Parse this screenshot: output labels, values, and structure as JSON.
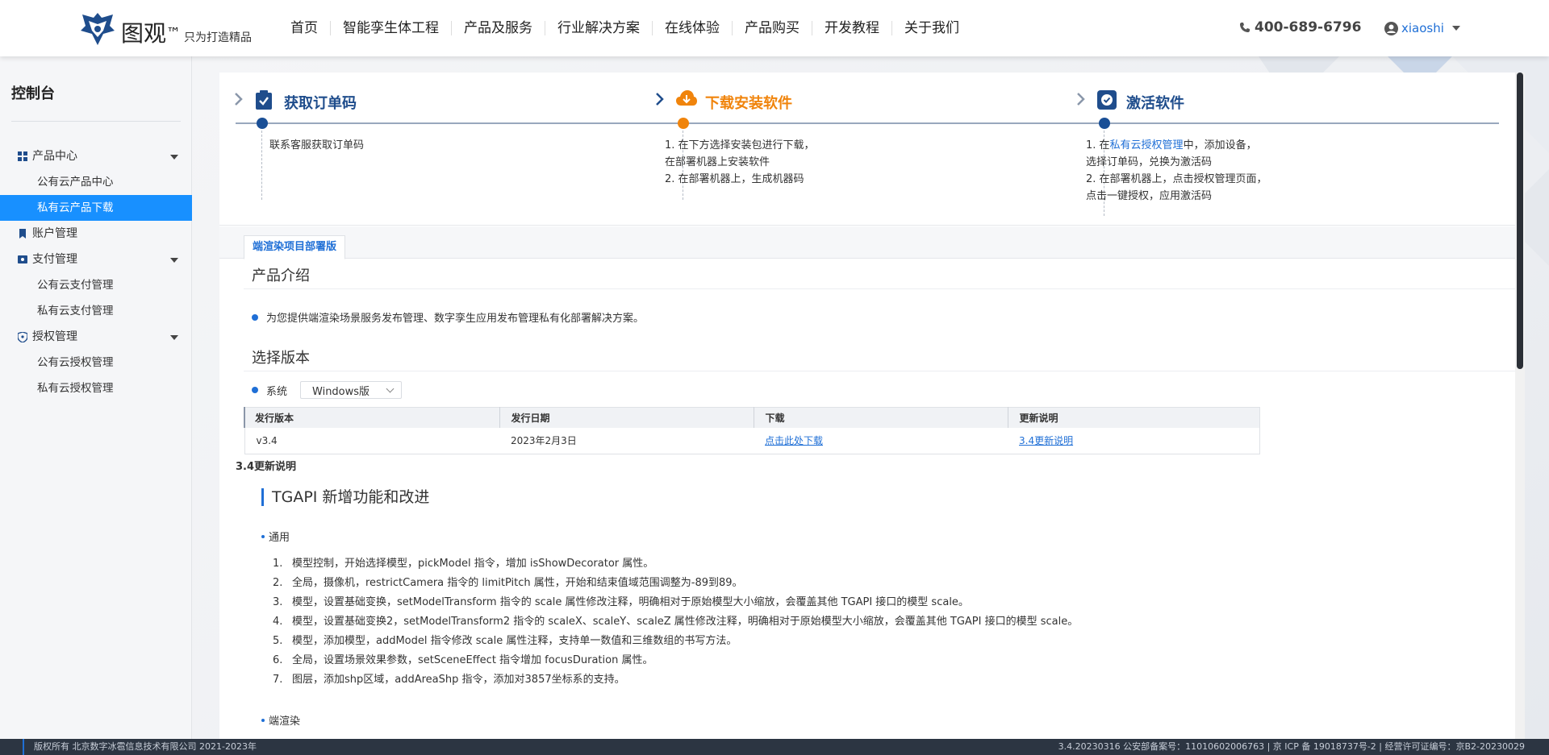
{
  "header": {
    "logo_text": "图观",
    "logo_tm": "™",
    "logo_slogan": "只为打造精品",
    "nav": [
      "首页",
      "智能孪生体工程",
      "产品及服务",
      "行业解决方案",
      "在线体验",
      "产品购买",
      "开发教程",
      "关于我们"
    ],
    "phone": "400-689-6796",
    "username": "xiaoshi"
  },
  "sidebar": {
    "title": "控制台",
    "groups": [
      {
        "label": "产品中心",
        "icon": "apps-icon",
        "items": [
          "公有云产品中心",
          "私有云产品下载"
        ]
      },
      {
        "label": "账户管理",
        "icon": "bookmark-icon",
        "items": []
      },
      {
        "label": "支付管理",
        "icon": "wallet-icon",
        "items": [
          "公有云支付管理",
          "私有云支付管理"
        ]
      },
      {
        "label": "授权管理",
        "icon": "shield-icon",
        "items": [
          "公有云授权管理",
          "私有云授权管理"
        ]
      }
    ],
    "active_item": "私有云产品下载"
  },
  "steps": [
    {
      "title": "获取订单码",
      "icon": "clipboard-check-icon",
      "lines": [
        "联系客服获取订单码"
      ]
    },
    {
      "title": "下载安装软件",
      "icon": "cloud-download-icon",
      "lines": [
        "1. 在下方选择安装包进行下载，",
        "在部署机器上安装软件",
        "2. 在部署机器上，生成机器码"
      ]
    },
    {
      "title": "激活软件",
      "icon": "badge-check-icon",
      "line1_prefix": "1. 在",
      "line1_link": "私有云授权管理",
      "line1_suffix": "中，添加设备，",
      "lines": [
        "选择订单码，兑换为激活码",
        "2. 在部署机器上，点击授权管理页面，",
        "点击一键授权，应用激活码"
      ]
    }
  ],
  "tab": "端渲染项目部署版",
  "intro": {
    "title": "产品介绍",
    "text": "为您提供端渲染场景服务发布管理、数字孪生应用发布管理私有化部署解决方案。"
  },
  "version": {
    "title": "选择版本",
    "system_label": "系统",
    "system_value": "Windows版",
    "table": {
      "headers": [
        "发行版本",
        "发行日期",
        "下载",
        "更新说明"
      ],
      "rows": [
        [
          "v3.4",
          "2023年2月3日",
          "点击此处下载",
          "3.4更新说明"
        ]
      ]
    }
  },
  "notes": {
    "title": "3.4更新说明",
    "api_heading": "TGAPI 新增功能和改进",
    "general_label": "通用",
    "changes": [
      "模型控制，开始选择模型，pickModel 指令，增加 isShowDecorator 属性。",
      "全局，摄像机，restrictCamera 指令的 limitPitch 属性，开始和结束值域范围调整为-89到89。",
      "模型，设置基础变换，setModelTransform 指令的 scale 属性修改注释，明确相对于原始模型大小缩放，会覆盖其他 TGAPI 接口的模型 scale。",
      "模型，设置基础变换2，setModelTransform2 指令的 scaleX、scaleY、scaleZ 属性修改注释，明确相对于原始模型大小缩放，会覆盖其他 TGAPI 接口的模型 scale。",
      "模型，添加模型，addModel 指令修改 scale 属性注释，支持单一数值和三维数组的书写方法。",
      "全局，设置场景效果参数，setSceneEffect 指令增加 focusDuration 属性。",
      "图层，添加shp区域，addAreaShp 指令，添加对3857坐标系的支持。"
    ],
    "render_label": "端渲染"
  },
  "footer": {
    "copyright": "版权所有 北京数字冰雹信息技术有限公司 2021-2023年",
    "right": "3.4.20230316 公安部备案号：11010602006763 | 京 ICP 备 19018737号-2 | 经营许可证编号：京B2-20230029"
  },
  "colors": {
    "primary": "#1f6fd6",
    "active_menu": "#1890ff",
    "step_current": "#f0840c",
    "step_done": "#1a4f96",
    "footer_bg": "#2c3542"
  }
}
